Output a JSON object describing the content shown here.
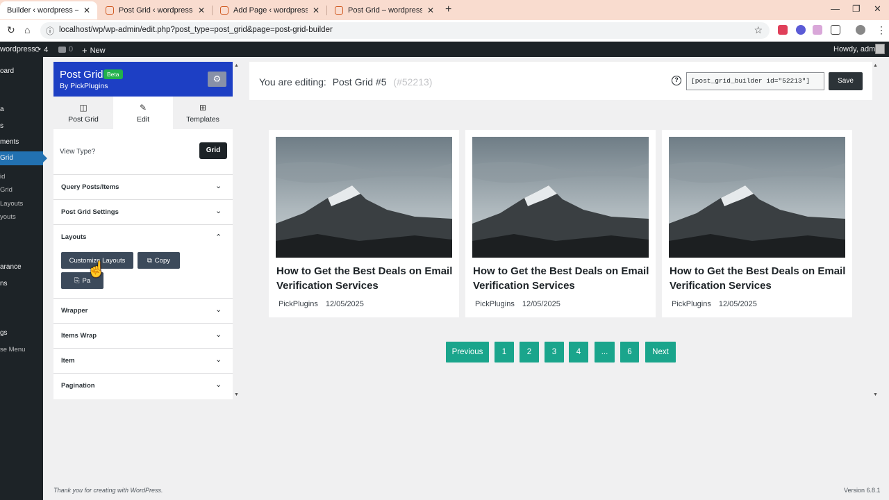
{
  "browser": {
    "tabs": [
      {
        "title": "Builder ‹ wordpress — WordPress",
        "close": "✕"
      },
      {
        "title": "Post Grid ‹ wordpress — WordPress",
        "close": "✕"
      },
      {
        "title": "Add Page ‹ wordpress — WordPress",
        "close": "✕"
      },
      {
        "title": "Post Grid – wordpress",
        "close": "✕"
      }
    ],
    "new_tab": "+",
    "url": "localhost/wp/wp-admin/edit.php?post_type=post_grid&page=post-grid-builder"
  },
  "adminbar": {
    "site": "wordpress",
    "updates": "4",
    "comments": "0",
    "new": "New",
    "howdy": "Howdy, admin"
  },
  "wp_menu": {
    "dashboard": "oard",
    "item2": "a",
    "item3": "s",
    "comments": "ments",
    "post_grid": "Grid",
    "sub1": "id",
    "sub2": "Grid",
    "sub3": "Layouts",
    "sub4": "youts",
    "appearance": "arance",
    "plugins": "ns",
    "settings": "gs",
    "collapse": "se Menu"
  },
  "panel": {
    "title": "Post Grid",
    "badge": "Beta",
    "subtitle": "By PickPlugins",
    "tabs": [
      "Post Grid",
      "Edit",
      "Templates"
    ],
    "view_type_label": "View Type?",
    "view_type_value": "Grid",
    "accordions": {
      "query": "Query Posts/Items",
      "settings": "Post Grid Settings",
      "layouts": "Layouts",
      "wrapper": "Wrapper",
      "items_wrap": "Items Wrap",
      "item": "Item",
      "pagination": "Pagination"
    },
    "layout_buttons": {
      "customize": "Customize Layouts",
      "copy": "Copy",
      "paste": "Pa"
    }
  },
  "editor": {
    "editing_label": "You are editing:",
    "grid_name": "Post Grid #5",
    "grid_id": "(#52213)",
    "shortcode": "[post_grid_builder id=\"52213\"]",
    "save": "Save"
  },
  "posts": [
    {
      "title": "How to Get the Best Deals on Email Verification Services",
      "author": "PickPlugins",
      "date": "12/05/2025"
    },
    {
      "title": "How to Get the Best Deals on Email Verification Services",
      "author": "PickPlugins",
      "date": "12/05/2025"
    },
    {
      "title": "How to Get the Best Deals on Email Verification Services",
      "author": "PickPlugins",
      "date": "12/05/2025"
    }
  ],
  "pagination": [
    "Previous",
    "1",
    "2",
    "3",
    "4",
    "...",
    "6",
    "Next"
  ],
  "footer": {
    "thanks": "Thank you for creating with WordPress.",
    "version": "Version 6.8.1"
  },
  "colors": {
    "panel_header": "#1d3fc4",
    "pagination": "#1aa58c",
    "wp_dark": "#1d2327",
    "wp_accent": "#2271b1",
    "beta_badge": "#22b14c"
  }
}
